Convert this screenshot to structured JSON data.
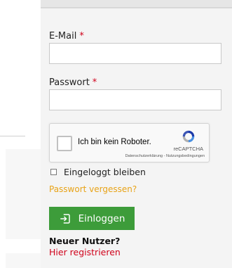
{
  "form": {
    "email_label": "E-Mail",
    "email_required_mark": "*",
    "email_value": "",
    "password_label": "Passwort",
    "password_required_mark": "*",
    "password_value": ""
  },
  "captcha": {
    "checkbox_label": "Ich bin kein Roboter.",
    "brand": "reCAPTCHA",
    "links": "Datenschutzerklärung - Nutzungsbedingungen",
    "icon": "recaptcha-logo"
  },
  "remember": {
    "label": "Eingeloggt bleiben",
    "checked": false
  },
  "forgot_password": "Passwort vergessen?",
  "login_button": {
    "label": "Einloggen",
    "icon": "login-icon"
  },
  "signup": {
    "prompt": "Neuer Nutzer?",
    "link": "Hier registrieren"
  },
  "colors": {
    "required": "#d0021b",
    "forgot_link": "#e8a317",
    "button_bg": "#3d9c3a",
    "register_link": "#d0021b"
  }
}
